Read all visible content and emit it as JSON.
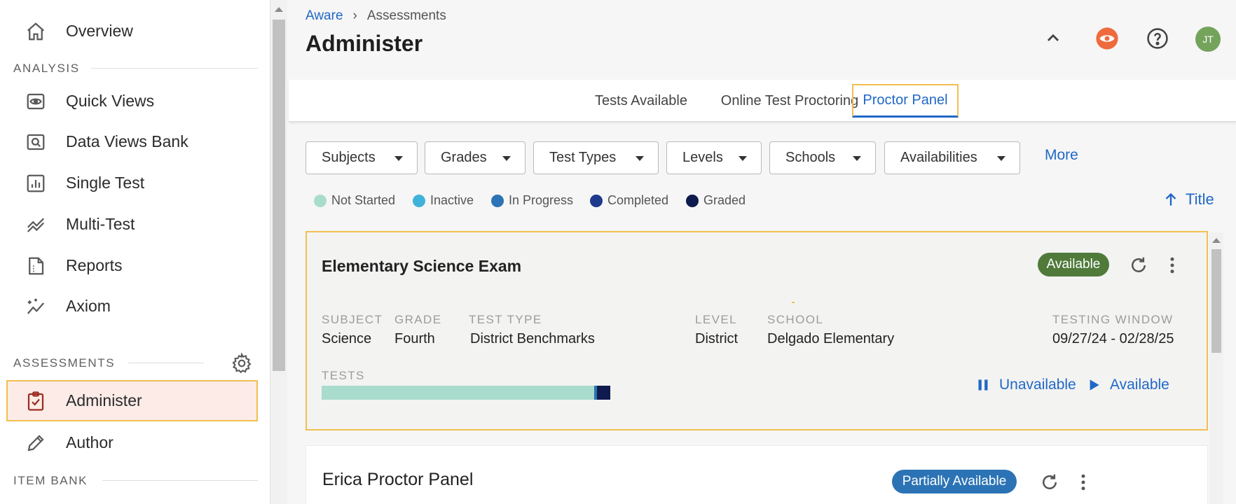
{
  "sidebar": {
    "items": [
      {
        "label": "Overview",
        "icon": "home-icon"
      },
      {
        "label": "Quick Views",
        "icon": "eye-icon"
      },
      {
        "label": "Data Views Bank",
        "icon": "search-box-icon"
      },
      {
        "label": "Single Test",
        "icon": "bar-chart-icon"
      },
      {
        "label": "Multi-Test",
        "icon": "trend-icon"
      },
      {
        "label": "Reports",
        "icon": "report-icon"
      },
      {
        "label": "Axiom",
        "icon": "sparkle-icon"
      },
      {
        "label": "Administer",
        "icon": "clipboard-check-icon"
      },
      {
        "label": "Author",
        "icon": "pencil-icon"
      }
    ],
    "sections": {
      "analysis": "ANALYSIS",
      "assessments": "ASSESSMENTS",
      "item_bank": "ITEM BANK"
    }
  },
  "header": {
    "breadcrumb_root": "Aware",
    "breadcrumb_current": "Assessments",
    "title": "Administer",
    "avatar_initials": "JT"
  },
  "tabs": [
    {
      "label": "Tests Available"
    },
    {
      "label": "Online Test Proctoring"
    },
    {
      "label": "Proctor Panel"
    }
  ],
  "filters": [
    {
      "label": "Subjects"
    },
    {
      "label": "Grades"
    },
    {
      "label": "Test Types"
    },
    {
      "label": "Levels"
    },
    {
      "label": "Schools"
    },
    {
      "label": "Availabilities"
    }
  ],
  "more_label": "More",
  "legend": [
    {
      "label": "Not Started",
      "color": "#a9dccd"
    },
    {
      "label": "Inactive",
      "color": "#3fb3d9"
    },
    {
      "label": "In Progress",
      "color": "#2b73b4"
    },
    {
      "label": "Completed",
      "color": "#1e3a8c"
    },
    {
      "label": "Graded",
      "color": "#0f1a4e"
    }
  ],
  "sort_label": "Title",
  "cards": [
    {
      "title": "Elementary Science Exam",
      "status": "Available",
      "status_color": "#4f7a3a",
      "fields": {
        "subject": {
          "label": "SUBJECT",
          "value": "Science"
        },
        "grade": {
          "label": "GRADE",
          "value": "Fourth"
        },
        "test_type": {
          "label": "TEST TYPE",
          "value": "District Benchmarks"
        },
        "level": {
          "label": "LEVEL",
          "value": "District"
        },
        "school": {
          "label": "SCHOOL",
          "value": "Delgado Elementary"
        },
        "window": {
          "label": "TESTING WINDOW",
          "value": "09/27/24 - 02/28/25"
        }
      },
      "tests_label": "TESTS",
      "tests_progress": [
        {
          "state": "Not Started",
          "fraction": 0.945
        },
        {
          "state": "In Progress",
          "fraction": 0.01
        },
        {
          "state": "Graded",
          "fraction": 0.045
        }
      ],
      "actions": {
        "unavailable": "Unavailable",
        "available": "Available"
      }
    },
    {
      "title": "Erica Proctor Panel",
      "status": "Partially Available",
      "status_color": "#2b73b4"
    }
  ],
  "colors": {
    "accent": "#2168c6",
    "highlight_border": "#f2bf52",
    "active_bg": "#fcebe7",
    "icon_color": "#5a5a5a",
    "admin_icon": "#9b2d20"
  }
}
